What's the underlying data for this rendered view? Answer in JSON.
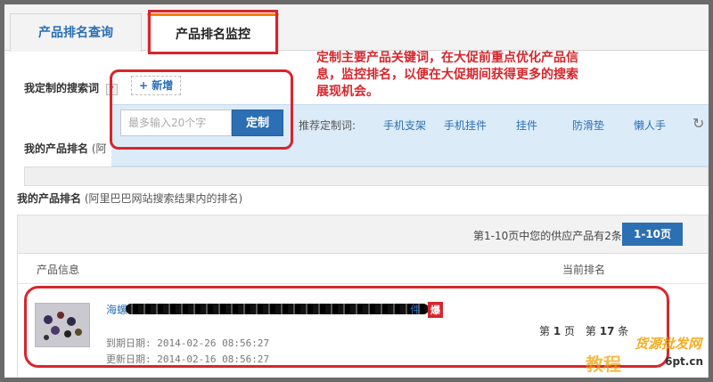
{
  "tabs": [
    {
      "label": "产品排名查询"
    },
    {
      "label": "产品排名监控"
    }
  ],
  "annotation": {
    "lines": [
      "定制主要产品关键词，在大促前重点优化产品信",
      "息，监控排名，以便在大促期间获得更多的搜索",
      "展现机会。"
    ]
  },
  "custom_search": {
    "label": "我定制的搜索词",
    "help": "?",
    "add_label": "新增",
    "add_icon": "+",
    "input_placeholder": "最多输入20个字",
    "submit_label": "定制",
    "recommend_label": "推荐定制词:",
    "recommended": [
      "手机支架",
      "手机挂件",
      "挂件",
      "防滑垫",
      "懒人手"
    ],
    "refresh_icon": "↻"
  },
  "ranking_hidden": {
    "title": "我的产品排名",
    "suffix": "(阿"
  },
  "ranking": {
    "title": "我的产品排名",
    "subtitle": "(阿里巴巴网站搜索结果内的排名)",
    "summary": "第1-10页中您的供应产品有2条",
    "page_button": "1-10页",
    "col_product": "产品信息",
    "col_rank": "当前排名",
    "item": {
      "title_start": "海螺",
      "title_end": "件",
      "hot_badge": "爆",
      "expire": "到期日期: 2014-02-26 08:56:27",
      "updated": "更新日期: 2014-02-16 08:56:27",
      "rank_prefix": "第",
      "rank_page": "1",
      "rank_page_unit": "页",
      "rank_pos_prefix": "第",
      "rank_pos": "17",
      "rank_pos_unit": "条"
    }
  },
  "watermark": {
    "line1": "货源批发网",
    "line2": "教程",
    "site": "6pt.cn"
  },
  "colors": {
    "accent_blue": "#2c6fb3",
    "annotation_red": "#d7262c",
    "tab_orange": "#f08200"
  }
}
